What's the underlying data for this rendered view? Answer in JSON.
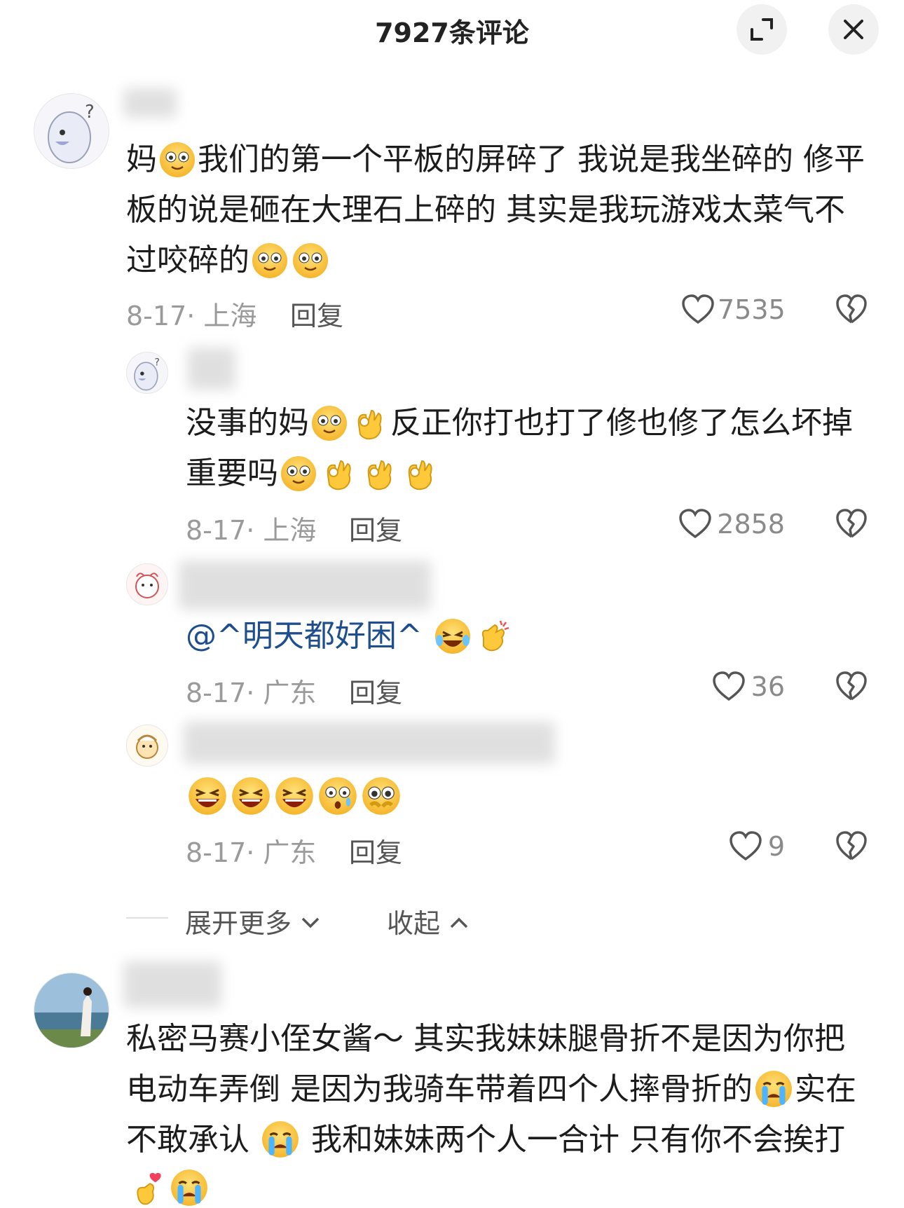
{
  "header": {
    "title": "7927条评论"
  },
  "comments": [
    {
      "line1": "妈",
      "line1b": "我们的第一个平板的屏碎了 我说是我坐碎的 修平",
      "line2": "板的说是砸在大理石上碎的 其实是我玩游戏太菜气不",
      "line3": "过咬碎的",
      "date": "8-17· 上海",
      "reply": "回复",
      "likes": "7535"
    },
    {
      "line1a": "没事的妈",
      "line1b": "反正你打也打了修也修了怎么坏掉",
      "line2": "重要吗",
      "date": "8-17· 上海",
      "reply": "回复",
      "likes": "2858"
    },
    {
      "mention": "@^明天都好困^",
      "date": "8-17· 广东",
      "reply": "回复",
      "likes": "36"
    },
    {
      "date": "8-17· 广东",
      "reply": "回复",
      "likes": "9"
    },
    {
      "line1": "私密马赛小侄女酱～ 其实我妹妹腿骨折不是因为你把",
      "line2a": "电动车弄倒 是因为我骑车带着四个人摔骨折的",
      "line2b": "实在",
      "line3a": "不敢承认",
      "line3b": "我和妹妹两个人一合计 只有你不会挨打"
    }
  ],
  "thread": {
    "expand": "展开更多",
    "collapse": "收起"
  }
}
